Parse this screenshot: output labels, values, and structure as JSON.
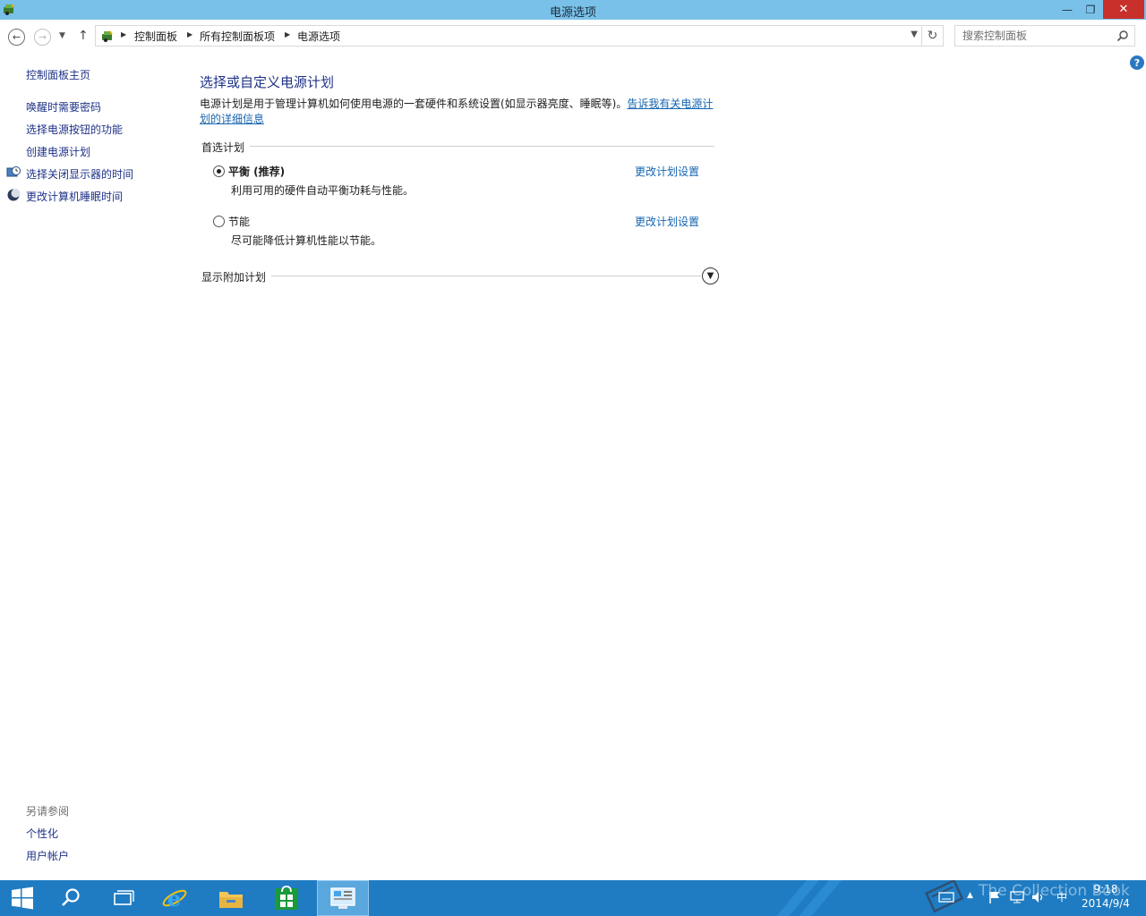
{
  "window": {
    "title": "电源选项",
    "minimize_glyph": "—",
    "maximize_glyph": "❐",
    "close_glyph": "✕"
  },
  "navigation": {
    "breadcrumb": [
      "控制面板",
      "所有控制面板项",
      "电源选项"
    ],
    "search_placeholder": "搜索控制面板"
  },
  "sidebar": {
    "home": "控制面板主页",
    "tasks": [
      {
        "label": "唤醒时需要密码",
        "icon": null
      },
      {
        "label": "选择电源按钮的功能",
        "icon": null
      },
      {
        "label": "创建电源计划",
        "icon": null
      },
      {
        "label": "选择关闭显示器的时间",
        "icon": "monitor-clock-icon"
      },
      {
        "label": "更改计算机睡眠时间",
        "icon": "moon-sleep-icon"
      }
    ],
    "see_also_header": "另请参阅",
    "see_also": [
      "个性化",
      "用户帐户"
    ]
  },
  "main": {
    "title": "选择或自定义电源计划",
    "description": "电源计划是用于管理计算机如何使用电源的一套硬件和系统设置(如显示器亮度、睡眠等)。",
    "description_link_line1": "告诉我有关电源计",
    "description_link_line2": "划的详细信息",
    "preferred_group": "首选计划",
    "plans": [
      {
        "name": "平衡 (推荐)",
        "description": "利用可用的硬件自动平衡功耗与性能。",
        "selected": true,
        "change_link": "更改计划设置"
      },
      {
        "name": "节能",
        "description": "尽可能降低计算机性能以节能。",
        "selected": false,
        "change_link": "更改计划设置"
      }
    ],
    "additional_group": "显示附加计划"
  },
  "taskbar": {
    "apps": [
      "start-icon",
      "search-icon",
      "task-view-icon",
      "internet-explorer-icon",
      "file-explorer-icon",
      "store-icon",
      "control-panel-icon"
    ],
    "active_app": "control-panel-icon",
    "watermark": "The Collection Book",
    "time": "9:18",
    "date": "2014/9/4",
    "ime": "中"
  },
  "colors": {
    "titlebar": "#7ac1ea",
    "taskbar": "#1f7cc2",
    "link": "#1565b0",
    "heading": "#1e3287",
    "close_button": "#c7302b"
  }
}
